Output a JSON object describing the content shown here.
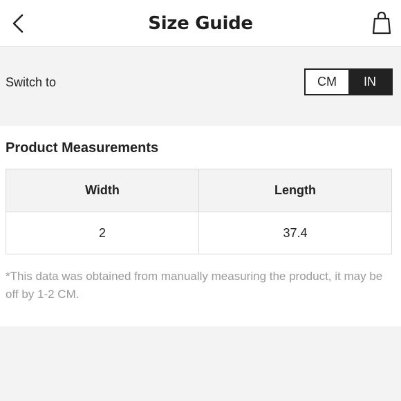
{
  "header": {
    "title": "Size Guide",
    "back_icon": "chevron-left-icon",
    "bag_icon": "shopping-bag-icon"
  },
  "unit_switch": {
    "label": "Switch to",
    "options": [
      "CM",
      "IN"
    ],
    "selected": "IN"
  },
  "measurements": {
    "title": "Product Measurements",
    "columns": [
      "Width",
      "Length"
    ],
    "rows": [
      [
        "2",
        "37.4"
      ]
    ],
    "note": "*This data was obtained from manually measuring the product, it may be off by 1-2 CM."
  },
  "colors": {
    "background": "#f3f3f3",
    "card": "#ffffff",
    "active_toggle": "#222222",
    "note_text": "#9a9a9a"
  }
}
